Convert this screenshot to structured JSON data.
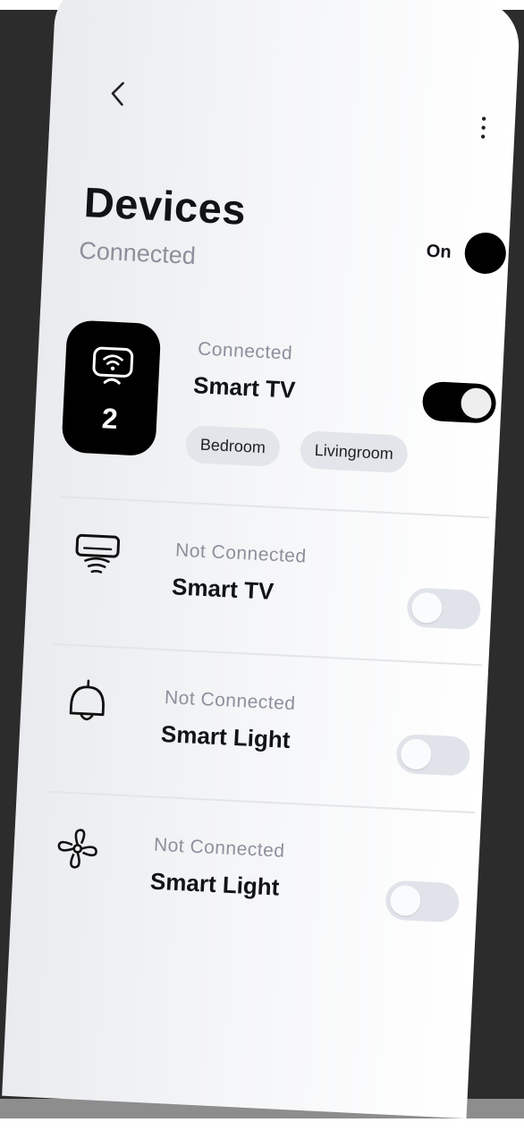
{
  "header": {
    "title": "Devices",
    "subtitle": "Connected"
  },
  "master": {
    "label": "On"
  },
  "devices": [
    {
      "status": "Connected",
      "name": "Smart TV",
      "count": "2",
      "tags": [
        "Bedroom",
        "Livingroom"
      ],
      "on": true,
      "icon": "wifi-monitor-icon"
    },
    {
      "status": "Not Connected",
      "name": "Smart TV",
      "on": false,
      "icon": "air-conditioner-icon"
    },
    {
      "status": "Not Connected",
      "name": "Smart Light",
      "on": false,
      "icon": "bell-lamp-icon"
    },
    {
      "status": "Not Connected",
      "name": "Smart Light",
      "on": false,
      "icon": "fan-icon"
    }
  ],
  "colors": {
    "accent": "#000000",
    "muted_text": "#8d8f9c",
    "toggle_off": "#e0e4ea",
    "tag_bg": "#e2e5e9"
  }
}
